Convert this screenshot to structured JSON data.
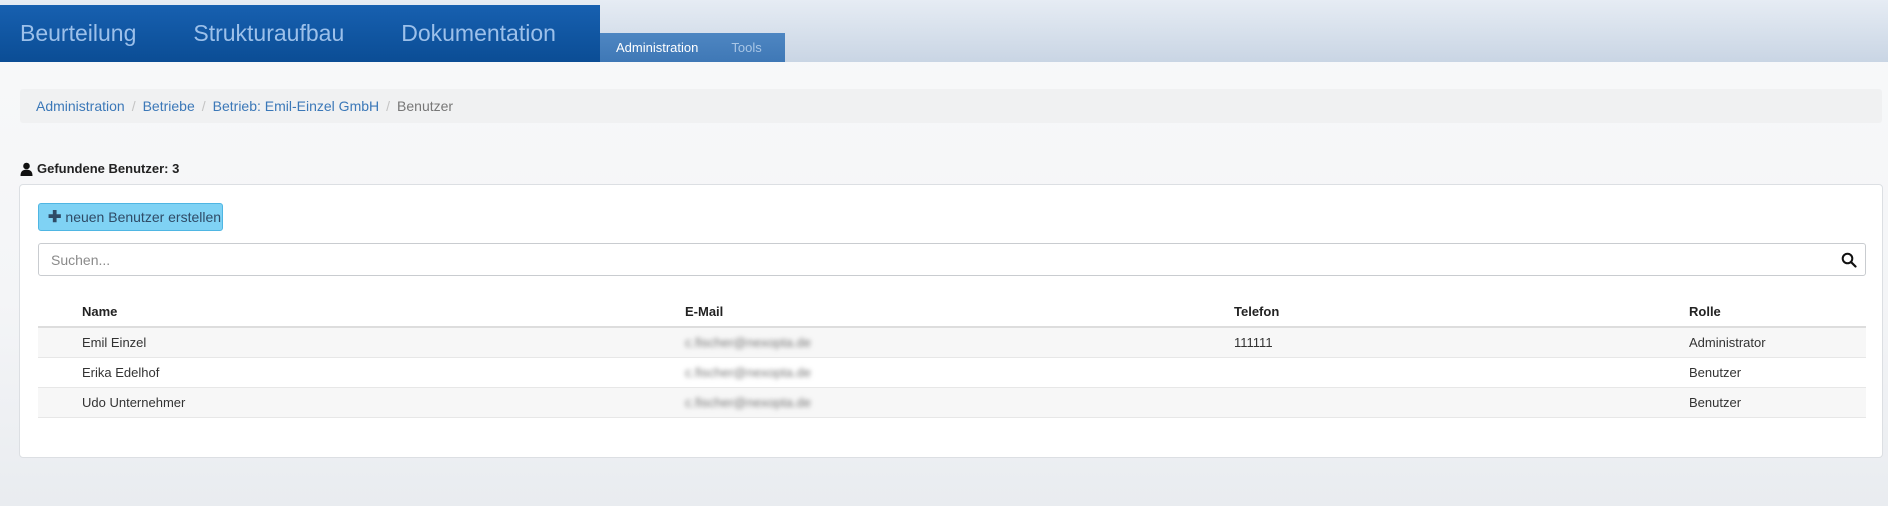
{
  "nav": {
    "main": [
      "Beurteilung",
      "Strukturaufbau",
      "Dokumentation"
    ],
    "sub": [
      {
        "label": "Administration",
        "active": true
      },
      {
        "label": "Tools",
        "active": false
      }
    ]
  },
  "breadcrumb": [
    "Administration",
    "Betriebe",
    "Betrieb: Emil-Einzel GmbH",
    "Benutzer"
  ],
  "count_heading": "Gefundene Benutzer: 3",
  "new_user_button": "neuen Benutzer erstellen",
  "search": {
    "placeholder": "Suchen...",
    "value": ""
  },
  "table": {
    "headers": [
      "Name",
      "E-Mail",
      "Telefon",
      "Rolle"
    ],
    "rows": [
      {
        "name": "Emil Einzel",
        "email": "c.fischer@nexopta.de",
        "phone": "111111",
        "role": "Administrator"
      },
      {
        "name": "Erika Edelhof",
        "email": "c.fischer@nexopta.de",
        "phone": "",
        "role": "Benutzer"
      },
      {
        "name": "Udo Unternehmer",
        "email": "c.fischer@nexopta.de",
        "phone": "",
        "role": "Benutzer"
      }
    ]
  },
  "colors": {
    "nav_blue": "#0b4d95",
    "link_blue": "#3b78b8",
    "button_bg": "#7fd2f4"
  },
  "icons": [
    "user-icon",
    "plus-icon",
    "search-icon"
  ]
}
